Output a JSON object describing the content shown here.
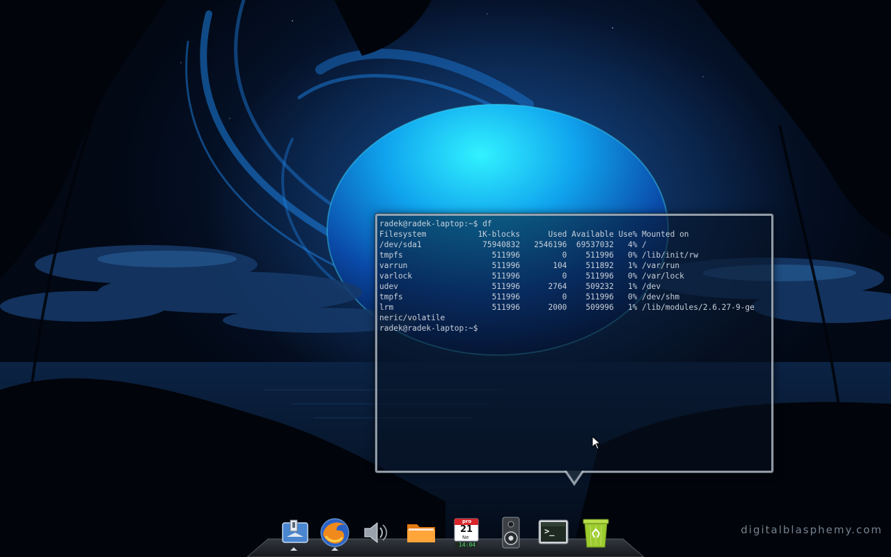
{
  "wallpaper": {
    "watermark": "digitalblasphemy.com"
  },
  "terminal": {
    "lines": [
      "radek@radek-laptop:~$ df",
      "Filesystem           1K-blocks      Used Available Use% Mounted on",
      "/dev/sda1             75940832   2546196  69537032   4% /",
      "tmpfs                   511996         0    511996   0% /lib/init/rw",
      "varrun                  511996       104    511892   1% /var/run",
      "varlock                 511996         0    511996   0% /var/lock",
      "udev                    511996      2764    509232   1% /dev",
      "tmpfs                   511996         0    511996   0% /dev/shm",
      "lrm                     511996      2000    509996   1% /lib/modules/2.6.27-9-ge",
      "neric/volatile",
      "radek@radek-laptop:~$"
    ]
  },
  "dock": {
    "items": [
      {
        "name": "dock-item-desktop-switcher",
        "icon": "desktop-switcher-icon",
        "running": true
      },
      {
        "name": "dock-item-firefox",
        "icon": "firefox-icon",
        "running": true
      },
      {
        "name": "dock-item-volume",
        "icon": "speaker-icon",
        "running": false
      },
      {
        "name": "dock-item-home-folder",
        "icon": "folder-icon",
        "running": false
      },
      {
        "name": "dock-item-calendar",
        "icon": "calendar-icon",
        "running": false
      },
      {
        "name": "dock-item-music-player",
        "icon": "music-speaker-icon",
        "running": false
      },
      {
        "name": "dock-item-terminal",
        "icon": "terminal-icon",
        "running": false
      },
      {
        "name": "dock-item-trash",
        "icon": "trash-icon",
        "running": false
      }
    ],
    "calendar": {
      "month": "pro",
      "day": "21",
      "weekday": "Ne",
      "time": "14:04"
    },
    "terminal_icon_prompt": ">_"
  },
  "colors": {
    "terminal_text": "#c8d0da",
    "popup_border": "#aab4be",
    "accent_blue": "#1a8ce0"
  }
}
